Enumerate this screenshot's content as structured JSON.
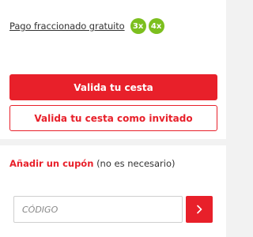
{
  "financing": {
    "label": "Pago fraccionado gratuito",
    "badges": [
      "3x",
      "4x"
    ],
    "badge_color": "#7cbf1e"
  },
  "checkout": {
    "primary_label": "Valida tu cesta",
    "guest_label": "Valida tu cesta como invitado",
    "accent_color": "#e8202a"
  },
  "coupon": {
    "title": "Añadir un cupón",
    "note": "(no es necesario)",
    "placeholder": "CÓDIGO",
    "submit_icon": "chevron-right-icon"
  }
}
